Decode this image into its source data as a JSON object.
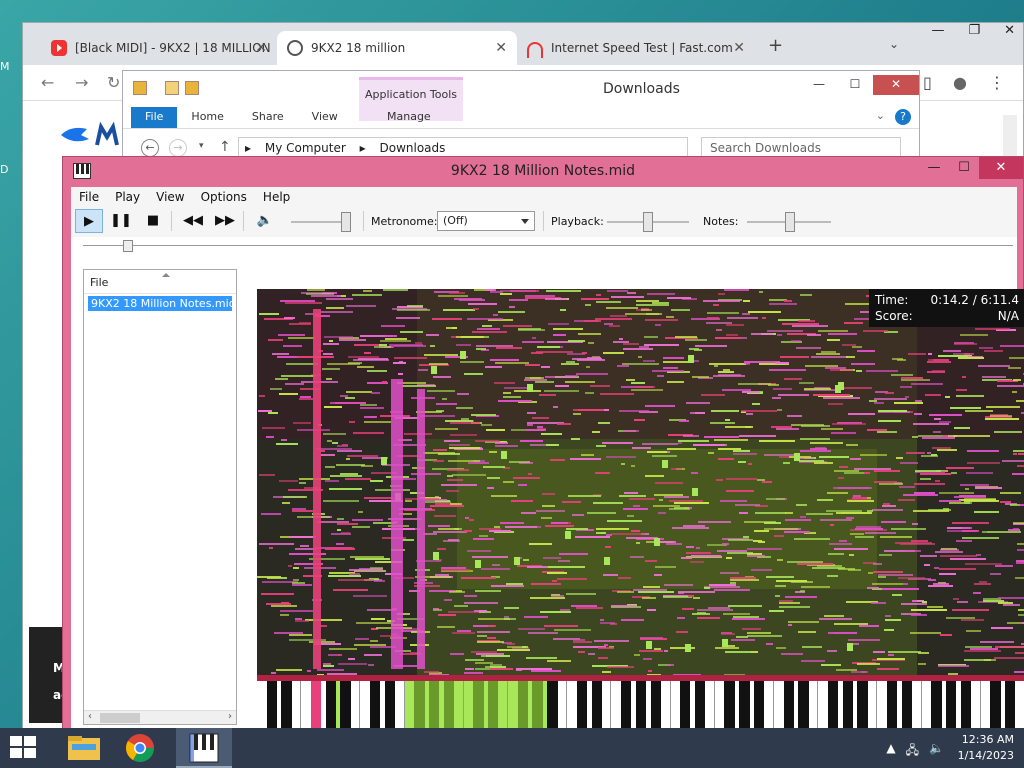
{
  "desktop": {
    "edge_labels": [
      "M",
      "D"
    ]
  },
  "browser": {
    "tabs": [
      {
        "label": "[Black MIDI] - 9KX2 | 18 MILLION",
        "icon": "youtube-icon"
      },
      {
        "label": "9KX2 18 million",
        "icon": "globe-icon"
      },
      {
        "label": "Internet Speed Test | Fast.com",
        "icon": "fast-icon"
      }
    ],
    "page_dark_lines": [
      "M",
      "ag"
    ]
  },
  "explorer": {
    "title": "Downloads",
    "app_tools": "Application Tools",
    "ribbon_tabs": [
      "File",
      "Home",
      "Share",
      "View"
    ],
    "manage_tab": "Manage",
    "path": [
      "My Computer",
      "Downloads"
    ],
    "search_placeholder": "Search Downloads"
  },
  "player": {
    "title": "9KX2 18 Million Notes.mid",
    "menu": [
      "File",
      "Play",
      "View",
      "Options",
      "Help"
    ],
    "metronome_label": "Metronome:",
    "metronome_value": "(Off)",
    "playback_label": "Playback:",
    "notes_label": "Notes:",
    "file_list_header": "File",
    "file_item": "9KX2 18 Million Notes.mid",
    "time_label": "Time:",
    "time_value": "0:14.2 / 6:11.4",
    "score_label": "Score:",
    "score_value": "N/A"
  },
  "taskbar": {
    "time": "12:36 AM",
    "date": "1/14/2023"
  },
  "colors": {
    "player_frame": "#e26f96",
    "note_green": "#a8e65a",
    "note_magenta": "#e050c8",
    "note_pink": "#e8407a",
    "pressed_key": "#a8e65a"
  }
}
